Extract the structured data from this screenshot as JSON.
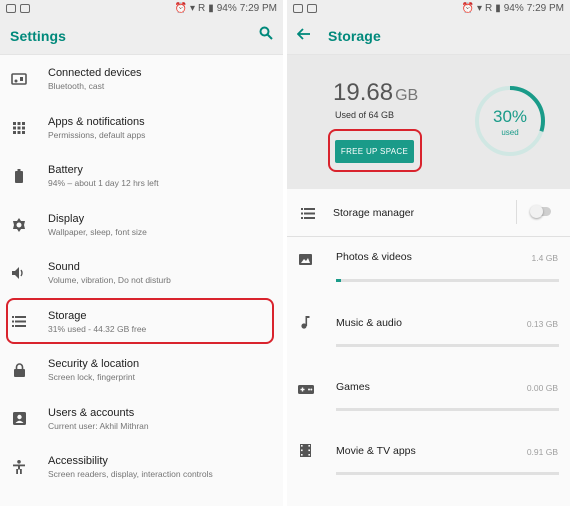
{
  "left_panel": {
    "statusbar": {
      "battery": "94%",
      "time": "7:29 PM",
      "network": "R"
    },
    "title": "Settings",
    "items": [
      {
        "title": "Connected devices",
        "subtitle": "Bluetooth, cast",
        "icon": "cast-icon"
      },
      {
        "title": "Apps & notifications",
        "subtitle": "Permissions, default apps",
        "icon": "apps-grid-icon"
      },
      {
        "title": "Battery",
        "subtitle": "94% – about 1 day 12 hrs left",
        "icon": "battery-icon"
      },
      {
        "title": "Display",
        "subtitle": "Wallpaper, sleep, font size",
        "icon": "brightness-icon"
      },
      {
        "title": "Sound",
        "subtitle": "Volume, vibration, Do not disturb",
        "icon": "volume-icon"
      },
      {
        "title": "Storage",
        "subtitle": "31% used - 44.32 GB free",
        "icon": "storage-icon"
      },
      {
        "title": "Security & location",
        "subtitle": "Screen lock, fingerprint",
        "icon": "lock-icon"
      },
      {
        "title": "Users & accounts",
        "subtitle": "Current user: Akhil Mithran",
        "icon": "account-icon"
      },
      {
        "title": "Accessibility",
        "subtitle": "Screen readers, display, interaction controls",
        "icon": "accessibility-icon"
      }
    ]
  },
  "right_panel": {
    "statusbar": {
      "battery": "94%",
      "time": "7:29 PM",
      "network": "R"
    },
    "title": "Storage",
    "used_amount": "19.68",
    "used_unit": "GB",
    "used_of": "Used of 64 GB",
    "free_up_label": "FREE UP SPACE",
    "percent_label": "30%",
    "percent_sub": "used",
    "percent_value": 30,
    "storage_manager_label": "Storage manager",
    "storage_manager_on": false,
    "categories": [
      {
        "label": "Photos & videos",
        "value": "1.4 GB",
        "fraction": 0.02,
        "icon": "photo-icon"
      },
      {
        "label": "Music & audio",
        "value": "0.13 GB",
        "fraction": 0.0,
        "icon": "music-note-icon"
      },
      {
        "label": "Games",
        "value": "0.00 GB",
        "fraction": 0.0,
        "icon": "gamepad-icon"
      },
      {
        "label": "Movie & TV apps",
        "value": "0.91 GB",
        "fraction": 0.0,
        "icon": "movie-icon"
      }
    ],
    "colors": {
      "accent": "#1a9b89",
      "highlight": "#d9232d"
    }
  }
}
